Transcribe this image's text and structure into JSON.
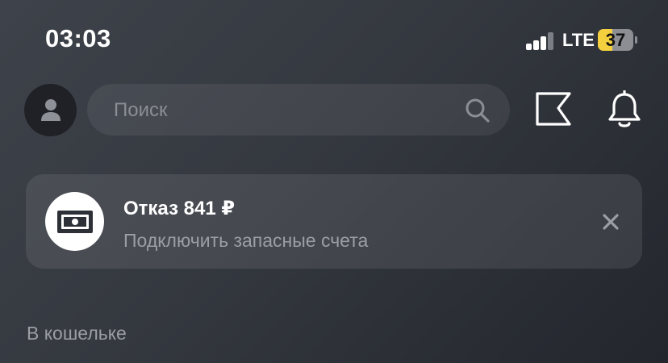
{
  "status_bar": {
    "time": "03:03",
    "network": "LTE",
    "battery_level": "37",
    "signal_bars_active": 3,
    "signal_bars_total": 4
  },
  "header": {
    "search_placeholder": "Поиск"
  },
  "notification": {
    "title": "Отказ 841 ₽",
    "subtitle": "Подключить запасные счета"
  },
  "wallet": {
    "section_label": "В кошельке"
  },
  "icons": {
    "avatar": "person-icon",
    "search": "search-icon",
    "flag": "flag-icon",
    "bell": "bell-icon",
    "card": "banknote-icon",
    "close": "close-icon"
  },
  "colors": {
    "background": "#3a3e45",
    "battery_fill": "#f4cf3e",
    "muted_text": "#9b9ea4"
  }
}
